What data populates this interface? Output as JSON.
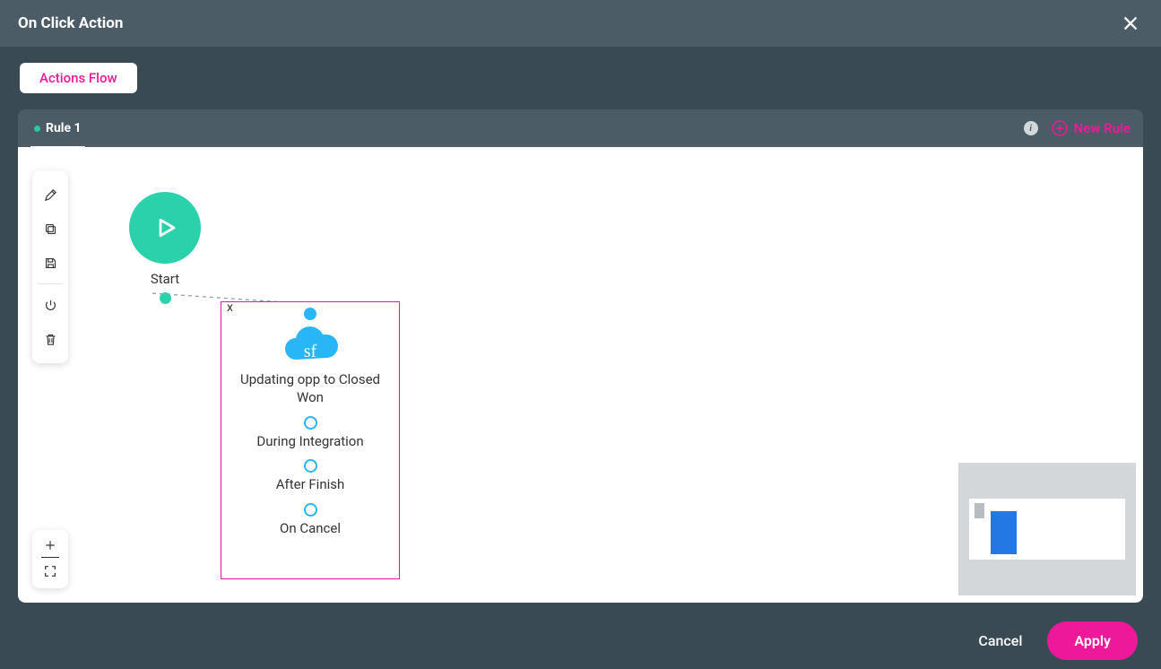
{
  "modal": {
    "title": "On Click Action",
    "actions_flow_label": "Actions Flow"
  },
  "tabs": {
    "rule_label": "Rule 1",
    "new_rule_label": "New Rule",
    "info_glyph": "i"
  },
  "toolbar": {
    "edit": "edit",
    "copy": "copy",
    "save": "save",
    "power": "power",
    "delete": "delete"
  },
  "canvas": {
    "start_label": "Start",
    "action": {
      "close_glyph": "x",
      "title": "Updating opp to Closed Won",
      "icon_text": "sf",
      "ports": [
        "During Integration",
        "After Finish",
        "On Cancel"
      ]
    }
  },
  "footer": {
    "cancel": "Cancel",
    "apply": "Apply"
  },
  "colors": {
    "accent_pink": "#ed199a",
    "start_green": "#2bd1aa",
    "node_blue": "#29b6f6",
    "bg_dark": "#3a4a54",
    "bg_header": "#4c5c66"
  }
}
